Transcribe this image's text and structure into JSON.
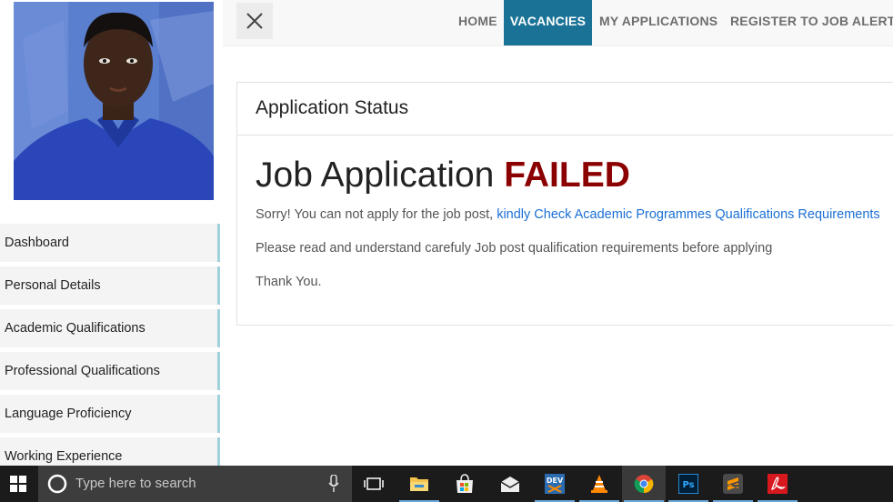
{
  "sidebar": {
    "items": [
      {
        "label": "Dashboard"
      },
      {
        "label": "Personal Details"
      },
      {
        "label": "Academic Qualifications"
      },
      {
        "label": "Professional Qualifications"
      },
      {
        "label": "Language Proficiency"
      },
      {
        "label": "Working Experience"
      }
    ]
  },
  "topnav": {
    "links": [
      {
        "label": "HOME"
      },
      {
        "label": "VACANCIES",
        "active": true
      },
      {
        "label": "MY APPLICATIONS"
      },
      {
        "label": "REGISTER TO JOB ALERTS"
      }
    ]
  },
  "card": {
    "title": "Application Status",
    "result_prefix": "Job Application",
    "result_status": "FAILED",
    "message1_prefix": "Sorry! You can not apply for the job post,",
    "message1_link": "kindly Check Academic Programmes Qualifications Requirements",
    "message2": "Please read and understand carefuly Job post qualification requirements before applying",
    "message3": "Thank You."
  },
  "taskbar": {
    "search_placeholder": "Type here to search",
    "apps": [
      "file-explorer",
      "store",
      "mail",
      "devexpress",
      "vlc",
      "chrome",
      "photoshop",
      "sublime-text",
      "acrobat-reader"
    ]
  },
  "colors": {
    "active_nav": "#1a7396",
    "failed": "#8b0000",
    "link": "#1a6fd6",
    "sidebar_border": "#9fd2da"
  }
}
